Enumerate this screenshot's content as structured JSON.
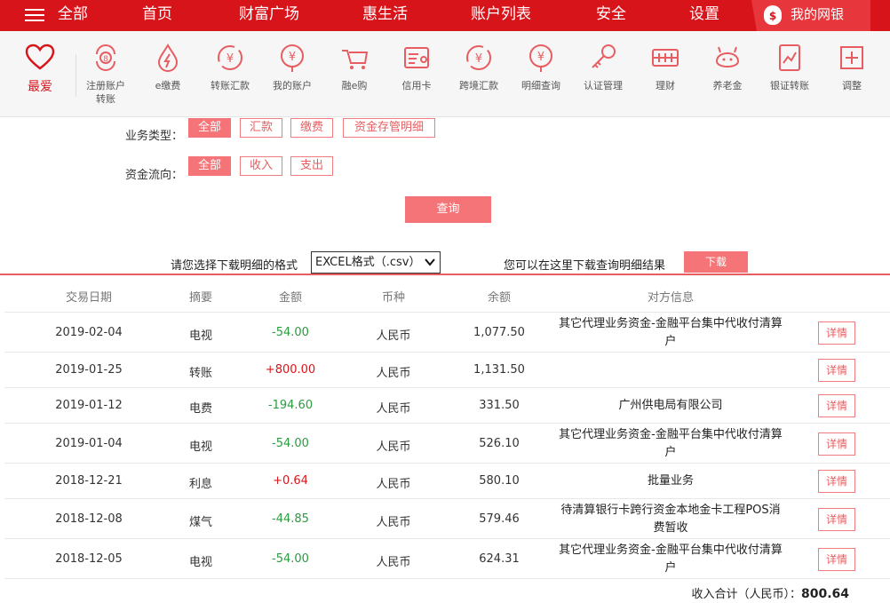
{
  "topnav": {
    "menu_label": "全部",
    "items": [
      "首页",
      "财富广场",
      "惠生活",
      "账户列表",
      "安全",
      "设置"
    ],
    "my_bank": "我的网银",
    "bag_symbol": "$"
  },
  "iconbar": {
    "favorite_label": "最爱",
    "items": [
      {
        "label": "注册账户\n转账",
        "icon": "register-transfer-icon"
      },
      {
        "label": "e缴费",
        "icon": "e-payment-icon"
      },
      {
        "label": "转账汇款",
        "icon": "transfer-icon"
      },
      {
        "label": "我的账户",
        "icon": "my-account-icon"
      },
      {
        "label": "融e购",
        "icon": "e-shop-icon"
      },
      {
        "label": "信用卡",
        "icon": "credit-card-icon"
      },
      {
        "label": "跨境汇款",
        "icon": "cross-border-icon"
      },
      {
        "label": "明细查询",
        "icon": "detail-query-icon"
      },
      {
        "label": "认证管理",
        "icon": "key-icon"
      },
      {
        "label": "理财",
        "icon": "finance-icon"
      },
      {
        "label": "养老金",
        "icon": "pension-icon"
      },
      {
        "label": "银证转账",
        "icon": "stock-transfer-icon"
      },
      {
        "label": "调整",
        "icon": "adjust-icon"
      }
    ],
    "accent": "#e85d61"
  },
  "filters": {
    "business_type_label": "业务类型：",
    "business_types": [
      "全部",
      "汇款",
      "缴费",
      "资金存管明细"
    ],
    "flow_label": "资金流向：",
    "flows": [
      "全部",
      "收入",
      "支出"
    ],
    "query_button": "查询"
  },
  "download": {
    "format_prompt": "请您选择下载明细的格式",
    "format_value": "EXCEL格式（.csv）",
    "hint": "您可以在这里下载查询明细结果",
    "button": "下载"
  },
  "table": {
    "headers": [
      "交易日期",
      "摘要",
      "金额",
      "币种",
      "余额",
      "对方信息"
    ],
    "detail_label": "详情",
    "rows": [
      {
        "date": "2019-02-04",
        "summary": "电视",
        "amount": "-54.00",
        "sign": "neg",
        "currency": "人民币",
        "balance": "1,077.50",
        "counterparty": "其它代理业务资金-金融平台集中代收付清算户"
      },
      {
        "date": "2019-01-25",
        "summary": "转账",
        "amount": "+800.00",
        "sign": "pos",
        "currency": "人民币",
        "balance": "1,131.50",
        "counterparty": ""
      },
      {
        "date": "2019-01-12",
        "summary": "电费",
        "amount": "-194.60",
        "sign": "neg",
        "currency": "人民币",
        "balance": "331.50",
        "counterparty": "广州供电局有限公司"
      },
      {
        "date": "2019-01-04",
        "summary": "电视",
        "amount": "-54.00",
        "sign": "neg",
        "currency": "人民币",
        "balance": "526.10",
        "counterparty": "其它代理业务资金-金融平台集中代收付清算户"
      },
      {
        "date": "2018-12-21",
        "summary": "利息",
        "amount": "+0.64",
        "sign": "pos",
        "currency": "人民币",
        "balance": "580.10",
        "counterparty": "批量业务"
      },
      {
        "date": "2018-12-08",
        "summary": "煤气",
        "amount": "-44.85",
        "sign": "neg",
        "currency": "人民币",
        "balance": "579.46",
        "counterparty": "待清算银行卡跨行资金本地金卡工程POS消费暂收"
      },
      {
        "date": "2018-12-05",
        "summary": "电视",
        "amount": "-54.00",
        "sign": "neg",
        "currency": "人民币",
        "balance": "624.31",
        "counterparty": "其它代理业务资金-金融平台集中代收付清算户"
      }
    ]
  },
  "summary": {
    "label": "收入合计（人民币）：",
    "value": "800.64"
  }
}
